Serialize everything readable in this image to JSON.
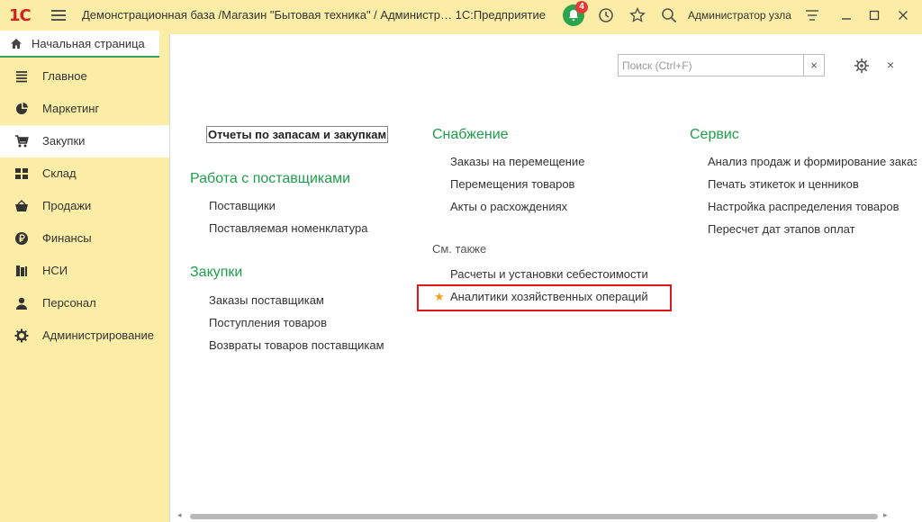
{
  "titlebar": {
    "logo": "1С",
    "title": "Демонстрационная база /Магазин \"Бытовая техника\" / Администр…  1С:Предприятие",
    "notifications_count": "4",
    "user": "Администратор узла"
  },
  "home_tab": {
    "label": "Начальная страница"
  },
  "sidebar": {
    "items": [
      {
        "label": "Главное",
        "icon": "menu-lines-icon"
      },
      {
        "label": "Маркетинг",
        "icon": "pie-chart-icon"
      },
      {
        "label": "Закупки",
        "icon": "cart-icon"
      },
      {
        "label": "Склад",
        "icon": "warehouse-grid-icon"
      },
      {
        "label": "Продажи",
        "icon": "basket-icon"
      },
      {
        "label": "Финансы",
        "icon": "ruble-icon"
      },
      {
        "label": "НСИ",
        "icon": "books-icon"
      },
      {
        "label": "Персонал",
        "icon": "person-icon"
      },
      {
        "label": "Администрирование",
        "icon": "gear-icon"
      }
    ],
    "active_index": 2
  },
  "search": {
    "placeholder": "Поиск (Ctrl+F)",
    "clear": "×"
  },
  "close_label": "×",
  "columns": {
    "col1": {
      "top_link": "Отчеты по запасам и закупкам",
      "sections": [
        {
          "title": "Работа с поставщиками",
          "links": [
            "Поставщики",
            "Поставляемая номенклатура"
          ]
        },
        {
          "title": "Закупки",
          "links": [
            "Заказы поставщикам",
            "Поступления товаров",
            "Возвраты товаров поставщикам"
          ]
        }
      ]
    },
    "col2": {
      "sections": [
        {
          "title": "Снабжение",
          "links": [
            "Заказы на перемещение",
            "Перемещения товаров",
            "Акты о расхождениях"
          ]
        }
      ],
      "see_also": "См. также",
      "see_also_links": [
        "Расчеты и установки себестоимости",
        "Аналитики хозяйственных операций"
      ],
      "star": "★"
    },
    "col3": {
      "sections": [
        {
          "title": "Сервис",
          "links": [
            "Анализ продаж и формирование заказ",
            "Печать этикеток и ценников",
            "Настройка распределения товаров",
            "Пересчет дат этапов оплат"
          ]
        }
      ]
    }
  },
  "colors": {
    "accent_green": "#1e9e4a",
    "panel_yellow": "#fbeda6",
    "highlight_red": "#e01818",
    "star_orange": "#f0a020"
  }
}
